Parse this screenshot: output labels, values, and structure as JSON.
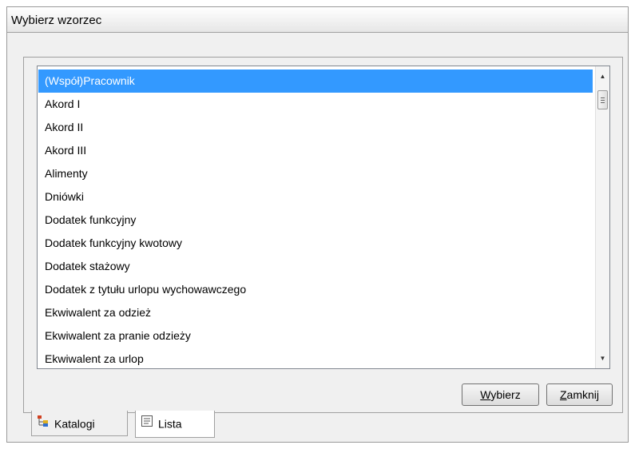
{
  "window": {
    "title": "Wybierz wzorzec"
  },
  "list": {
    "items": [
      "(Współ)Pracownik",
      "Akord I",
      "Akord II",
      "Akord III",
      "Alimenty",
      "Dniówki",
      "Dodatek funkcyjny",
      "Dodatek funkcyjny kwotowy",
      "Dodatek stażowy",
      "Dodatek z tytułu urlopu wychowawczego",
      "Ekwiwalent za odzież",
      "Ekwiwalent za pranie odzieży",
      "Ekwiwalent za urlop"
    ],
    "selected_index": 0
  },
  "buttons": {
    "select_label": "Wybierz",
    "close_label": "Zamknij"
  },
  "tabs": [
    {
      "label": "Katalogi",
      "icon": "tree-icon",
      "active": false
    },
    {
      "label": "Lista",
      "icon": "list-icon",
      "active": true
    }
  ],
  "colors": {
    "selection": "#3399ff",
    "selection_text": "#ffffff",
    "background": "#f0f0f0"
  }
}
